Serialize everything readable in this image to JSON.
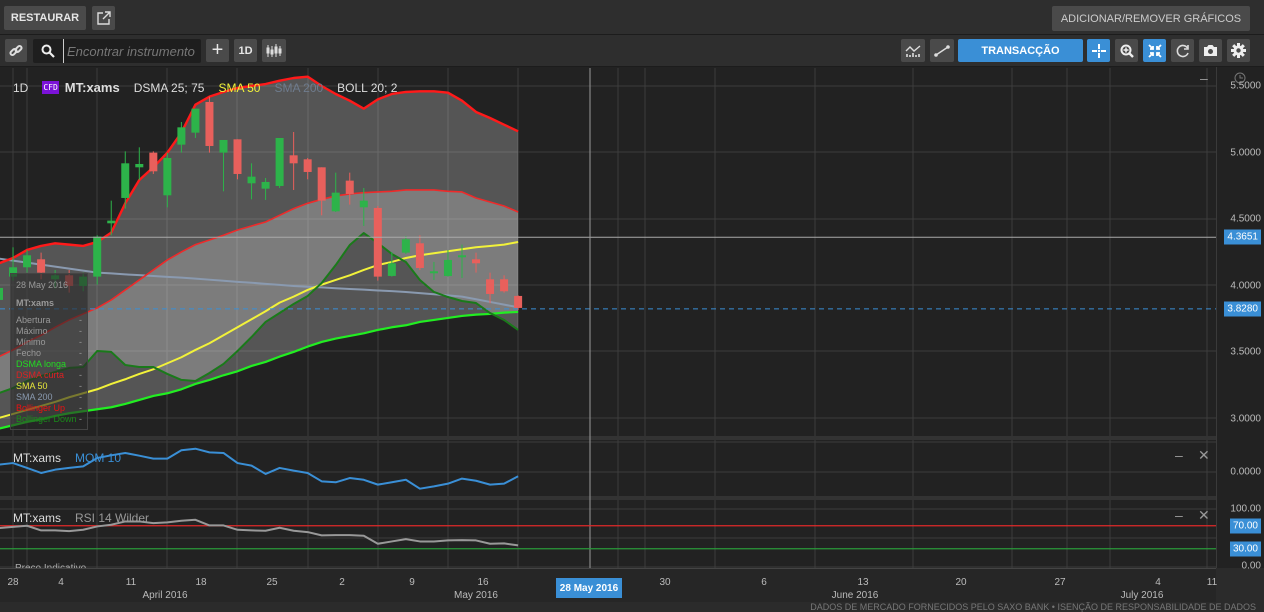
{
  "toolbar": {
    "restore_label": "RESTAURAR",
    "add_remove_label": "ADICIONAR/REMOVER GRÁFICOS",
    "search_placeholder": "Encontrar instrumento",
    "search_value": "",
    "interval_label": "1D",
    "transaction_label": "TRANSACÇÃO"
  },
  "legend": {
    "interval": "1D",
    "badge": "CFD",
    "instrument": "MT:xams",
    "dsma": "DSMA 25; 75",
    "sma50": "SMA 50",
    "sma200": "SMA 200",
    "boll": "BOLL 20; 2"
  },
  "tooltip": {
    "date": "28 May 2016",
    "instrument": "MT:xams",
    "rows": [
      {
        "label": "Abertura",
        "value": "-"
      },
      {
        "label": "Máximo",
        "value": "-"
      },
      {
        "label": "Mínimo",
        "value": "-"
      },
      {
        "label": "Fecho",
        "value": "-"
      },
      {
        "label": "DSMA longa",
        "value": "-"
      },
      {
        "label": "DSMA curta",
        "value": "-"
      },
      {
        "label": "SMA 50",
        "value": "-"
      },
      {
        "label": "SMA 200",
        "value": "-"
      },
      {
        "label": "Bollinger Up",
        "value": "-"
      },
      {
        "label": "Bollinger Down",
        "value": "-"
      }
    ]
  },
  "price_axis": {
    "ticks": [
      "5.5000",
      "5.0000",
      "4.5000",
      "4.0000",
      "3.5000",
      "3.0000"
    ],
    "crosshair_value": "4.3651",
    "last_price": "3.8280"
  },
  "mom_panel": {
    "instrument": "MT:xams",
    "indicator": "MOM 10",
    "axis_label": "0.0000"
  },
  "rsi_panel": {
    "instrument": "MT:xams",
    "indicator": "RSI 14 Wilder",
    "axis_labels": [
      "100.00",
      "0.00"
    ],
    "upper": "70.00",
    "lower": "30.00",
    "footer_label": "Preço Indicativo"
  },
  "date_axis": {
    "days": [
      "28",
      "4",
      "11",
      "18",
      "25",
      "2",
      "9",
      "16",
      "30",
      "6",
      "13",
      "20",
      "27",
      "4",
      "11"
    ],
    "months": [
      "April 2016",
      "May 2016",
      "June 2016",
      "July 2016"
    ],
    "crosshair_date": "28 May 2016"
  },
  "footer": "DADOS DE MERCADO FORNECIDOS PELO SAXO BANK • ISENÇÃO DE RESPONSABILIDADE DE DADOS",
  "colors": {
    "accent": "#3a8fd6",
    "up": "#2db34a",
    "down": "#e8605c",
    "boll_up": "#ff1a1a",
    "boll_down": "#1a7a1a",
    "dsma_long": "#22ee22",
    "dsma_short": "#ee2a2a",
    "sma50": "#f2f23a",
    "sma200": "#8a9ab0"
  },
  "chart_data": {
    "type": "candlestick",
    "instrument": "MT:xams",
    "ylim": [
      2.9,
      5.6
    ],
    "candles": [
      [
        3.895,
        4.0,
        3.87,
        3.985
      ],
      [
        4.07,
        4.29,
        4.04,
        4.14
      ],
      [
        4.14,
        4.27,
        4.1,
        4.23
      ],
      [
        4.2,
        4.25,
        4.05,
        4.1
      ],
      [
        4.05,
        4.12,
        3.98,
        4.08
      ],
      [
        4.08,
        4.12,
        3.95,
        4.0
      ],
      [
        4.0,
        4.1,
        3.96,
        4.07
      ],
      [
        4.07,
        4.38,
        4.01,
        4.37
      ],
      [
        4.47,
        4.64,
        4.38,
        4.49
      ],
      [
        4.66,
        5.01,
        4.58,
        4.92
      ],
      [
        4.89,
        5.04,
        4.795,
        4.915
      ],
      [
        5.0,
        5.01,
        4.84,
        4.86
      ],
      [
        4.68,
        5.0,
        4.59,
        4.96
      ],
      [
        5.06,
        5.23,
        5.0,
        5.19
      ],
      [
        5.15,
        5.33,
        5.11,
        5.33
      ],
      [
        5.38,
        5.42,
        5.0,
        5.05
      ],
      [
        5.0,
        5.095,
        4.71,
        5.095
      ],
      [
        5.1,
        5.1,
        4.8,
        4.84
      ],
      [
        4.77,
        4.92,
        4.65,
        4.82
      ],
      [
        4.73,
        4.81,
        4.645,
        4.78
      ],
      [
        4.75,
        5.11,
        4.735,
        5.11
      ],
      [
        4.98,
        5.155,
        4.72,
        4.92
      ],
      [
        4.95,
        4.96,
        4.8,
        4.855
      ],
      [
        4.89,
        4.89,
        4.53,
        4.64
      ],
      [
        4.56,
        4.85,
        4.555,
        4.7
      ],
      [
        4.79,
        4.85,
        4.61,
        4.69
      ],
      [
        4.59,
        4.735,
        4.45,
        4.64
      ],
      [
        4.585,
        4.6,
        4.04,
        4.07
      ],
      [
        4.075,
        4.255,
        4.07,
        4.17
      ],
      [
        4.25,
        4.375,
        4.24,
        4.35
      ],
      [
        4.32,
        4.38,
        4.12,
        4.135
      ],
      [
        4.105,
        4.18,
        4.045,
        4.11
      ],
      [
        4.075,
        4.27,
        4.07,
        4.195
      ],
      [
        4.215,
        4.31,
        4.06,
        4.23
      ],
      [
        4.2,
        4.25,
        4.1,
        4.17
      ],
      [
        4.05,
        4.1,
        3.87,
        3.94
      ],
      [
        4.05,
        4.08,
        3.95,
        3.96
      ],
      [
        3.925,
        3.93,
        3.82,
        3.835
      ]
    ],
    "series": [
      {
        "name": "Bollinger Up",
        "values": [
          4.17,
          4.21,
          4.27,
          4.3,
          4.32,
          4.31,
          4.3,
          4.33,
          4.4,
          4.62,
          4.795,
          4.89,
          5.0,
          5.15,
          5.36,
          5.42,
          5.455,
          5.485,
          5.5,
          5.515,
          5.54,
          5.56,
          5.57,
          5.5,
          5.44,
          5.39,
          5.33,
          5.4,
          5.44,
          5.455,
          5.46,
          5.46,
          5.45,
          5.39,
          5.305,
          5.26,
          5.21,
          5.16
        ]
      },
      {
        "name": "Bollinger Down",
        "values": [
          3.197,
          3.234,
          3.287,
          3.324,
          3.355,
          3.385,
          3.392,
          3.512,
          3.505,
          3.407,
          3.392,
          3.392,
          3.34,
          3.295,
          3.287,
          3.347,
          3.415,
          3.512,
          3.617,
          3.73,
          3.797,
          3.865,
          3.925,
          4.022,
          4.157,
          4.307,
          4.397,
          4.322,
          4.24,
          4.18,
          4.045,
          3.955,
          3.917,
          3.887,
          3.872,
          3.797,
          3.745,
          3.67
        ]
      },
      {
        "name": "DSMA curta",
        "values": [
          3.47,
          3.52,
          3.58,
          3.63,
          3.69,
          3.745,
          3.79,
          3.835,
          3.895,
          3.97,
          4.045,
          4.12,
          4.195,
          4.255,
          4.31,
          4.345,
          4.38,
          4.42,
          4.45,
          4.48,
          4.53,
          4.58,
          4.62,
          4.65,
          4.675,
          4.69,
          4.7,
          4.705,
          4.71,
          4.72,
          4.72,
          4.72,
          4.71,
          4.705,
          4.66,
          4.63,
          4.6,
          4.555
        ]
      },
      {
        "name": "DSMA longa",
        "values": [
          2.93,
          2.955,
          2.98,
          3.0,
          3.025,
          3.045,
          3.06,
          3.075,
          3.09,
          3.115,
          3.145,
          3.175,
          3.195,
          3.225,
          3.265,
          3.295,
          3.33,
          3.36,
          3.4,
          3.43,
          3.47,
          3.505,
          3.545,
          3.58,
          3.605,
          3.625,
          3.645,
          3.67,
          3.69,
          3.705,
          3.73,
          3.745,
          3.76,
          3.775,
          3.785,
          3.79,
          3.8,
          3.805
        ]
      },
      {
        "name": "SMA 50",
        "values": [
          3.01,
          3.04,
          3.07,
          3.1,
          3.13,
          3.165,
          3.195,
          3.225,
          3.265,
          3.3,
          3.34,
          3.375,
          3.42,
          3.465,
          3.52,
          3.57,
          3.63,
          3.69,
          3.75,
          3.81,
          3.875,
          3.92,
          3.97,
          4.01,
          4.045,
          4.08,
          4.12,
          4.157,
          4.18,
          4.21,
          4.23,
          4.245,
          4.26,
          4.275,
          4.29,
          4.3,
          4.31,
          4.33
        ]
      },
      {
        "name": "SMA 200",
        "values": [
          4.205,
          4.19,
          4.175,
          4.16,
          4.145,
          4.13,
          4.115,
          4.1,
          4.094,
          4.087,
          4.081,
          4.075,
          4.068,
          4.062,
          4.055,
          4.047,
          4.039,
          4.031,
          4.024,
          4.016,
          4.008,
          4.0,
          3.994,
          3.989,
          3.983,
          3.977,
          3.972,
          3.966,
          3.961,
          3.955,
          3.946,
          3.938,
          3.929,
          3.92,
          3.9,
          3.88,
          3.86,
          3.84
        ]
      }
    ],
    "mom10": [
      0.38,
      0.46,
      0.21,
      -0.05,
      0.12,
      0.21,
      0.29,
      0.72,
      0.86,
      0.98,
      0.84,
      0.69,
      0.69,
      1.12,
      1.2,
      1.01,
      0.98,
      0.46,
      0.33,
      -0.1,
      0.21,
      0.07,
      -0.05,
      -0.48,
      -0.53,
      -0.31,
      -0.4,
      -0.65,
      -0.53,
      -0.4,
      -0.86,
      -0.74,
      -0.6,
      -0.34,
      -0.45,
      -0.65,
      -0.6,
      -0.22
    ],
    "rsi14": [
      65.9,
      68,
      70,
      61.9,
      61.9,
      60.7,
      63,
      68.8,
      71.7,
      77.5,
      77.5,
      74.6,
      75.8,
      78.7,
      80.4,
      70.6,
      70.6,
      63,
      61.9,
      61.3,
      66.5,
      61.3,
      59,
      53.2,
      53.8,
      53.8,
      52.6,
      38.7,
      42.7,
      46.8,
      42.7,
      42.7,
      44.5,
      45.1,
      44.5,
      38.7,
      39.3,
      35.8
    ],
    "rsi_levels": [
      70,
      30
    ],
    "crosshair_price": 4.3651,
    "last_price": 3.828
  }
}
